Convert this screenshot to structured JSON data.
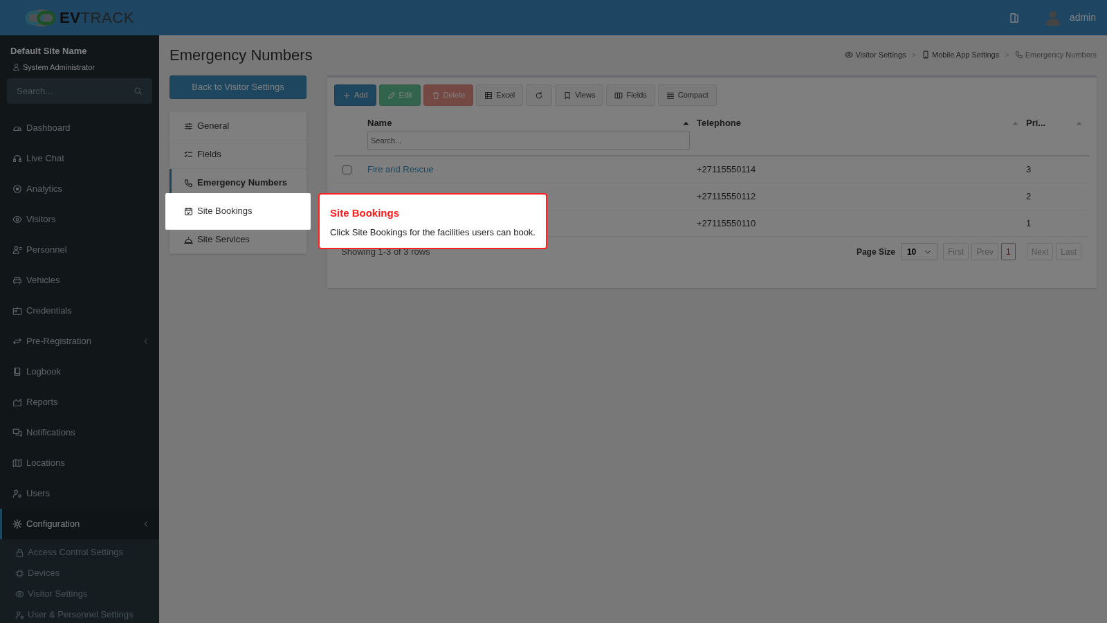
{
  "header": {
    "logo_bold": "EV",
    "logo_light": "TRACK",
    "user": "admin"
  },
  "sidebar": {
    "site_name": "Default Site Name",
    "role": "System Administrator",
    "search_placeholder": "Search...",
    "items": [
      {
        "label": "Dashboard",
        "selected": false,
        "collapsible": false
      },
      {
        "label": "Live Chat",
        "selected": false,
        "collapsible": false
      },
      {
        "label": "Analytics",
        "selected": false,
        "collapsible": false
      },
      {
        "label": "Visitors",
        "selected": false,
        "collapsible": false
      },
      {
        "label": "Personnel",
        "selected": false,
        "collapsible": false
      },
      {
        "label": "Vehicles",
        "selected": false,
        "collapsible": false
      },
      {
        "label": "Credentials",
        "selected": false,
        "collapsible": false
      },
      {
        "label": "Pre-Registration",
        "selected": false,
        "collapsible": true
      },
      {
        "label": "Logbook",
        "selected": false,
        "collapsible": false
      },
      {
        "label": "Reports",
        "selected": false,
        "collapsible": false
      },
      {
        "label": "Notifications",
        "selected": false,
        "collapsible": false
      },
      {
        "label": "Locations",
        "selected": false,
        "collapsible": false
      },
      {
        "label": "Users",
        "selected": false,
        "collapsible": false
      },
      {
        "label": "Configuration",
        "selected": true,
        "collapsible": true
      }
    ],
    "subitems": [
      "Access Control Settings",
      "Devices",
      "Visitor Settings",
      "User & Personnel Settings"
    ]
  },
  "page": {
    "title": "Emergency Numbers",
    "back_button": "Back to Visitor Settings",
    "breadcrumbs": [
      "Visitor Settings",
      "Mobile App Settings",
      "Emergency Numbers"
    ],
    "breadcrumb_separator": ">",
    "settings_menu": [
      {
        "label": "General",
        "selected": false,
        "highlighted": false
      },
      {
        "label": "Fields",
        "selected": false,
        "highlighted": false
      },
      {
        "label": "Emergency Numbers",
        "selected": true,
        "highlighted": false
      },
      {
        "label": "Site Bookings",
        "selected": false,
        "highlighted": true
      },
      {
        "label": "Site Services",
        "selected": false,
        "highlighted": false
      }
    ]
  },
  "toolbar": [
    {
      "label": "Add",
      "kind": "primary",
      "disabled": false
    },
    {
      "label": "Edit",
      "kind": "success",
      "disabled": true
    },
    {
      "label": "Delete",
      "kind": "danger",
      "disabled": true
    },
    {
      "label": "Excel",
      "kind": "default",
      "disabled": false
    },
    {
      "kind": "refresh",
      "disabled": false
    },
    {
      "label": "Views",
      "kind": "default",
      "disabled": false
    },
    {
      "label": "Fields",
      "kind": "default",
      "disabled": false
    },
    {
      "label": "Compact",
      "kind": "default",
      "disabled": false
    }
  ],
  "table": {
    "columns": [
      {
        "label": "Name",
        "sorted": true,
        "filter_placeholder": "Search..."
      },
      {
        "label": "Telephone",
        "sorted": false
      },
      {
        "label": "Pri...",
        "sorted": false
      }
    ],
    "rows": [
      {
        "checked": false,
        "name": "Fire and Rescue",
        "telephone": "+27115550114",
        "priority": "3"
      },
      {
        "telephone": "+27115550112",
        "priority": "2"
      },
      {
        "telephone": "+27115550110",
        "priority": "1"
      }
    ],
    "summary": "Showing 1-3 of 3 rows",
    "page_size_label": "Page Size",
    "page_size": "10",
    "pager": [
      {
        "label": "First",
        "selected": false,
        "disabled": true
      },
      {
        "label": "Prev",
        "selected": false,
        "disabled": true
      },
      {
        "label": "1",
        "selected": true,
        "disabled": false
      },
      {
        "label": "Next",
        "selected": false,
        "disabled": true
      },
      {
        "label": "Last",
        "selected": false,
        "disabled": true
      }
    ]
  },
  "tour": {
    "title": "Site Bookings",
    "text": "Click Site Bookings for the facilities users can book."
  }
}
